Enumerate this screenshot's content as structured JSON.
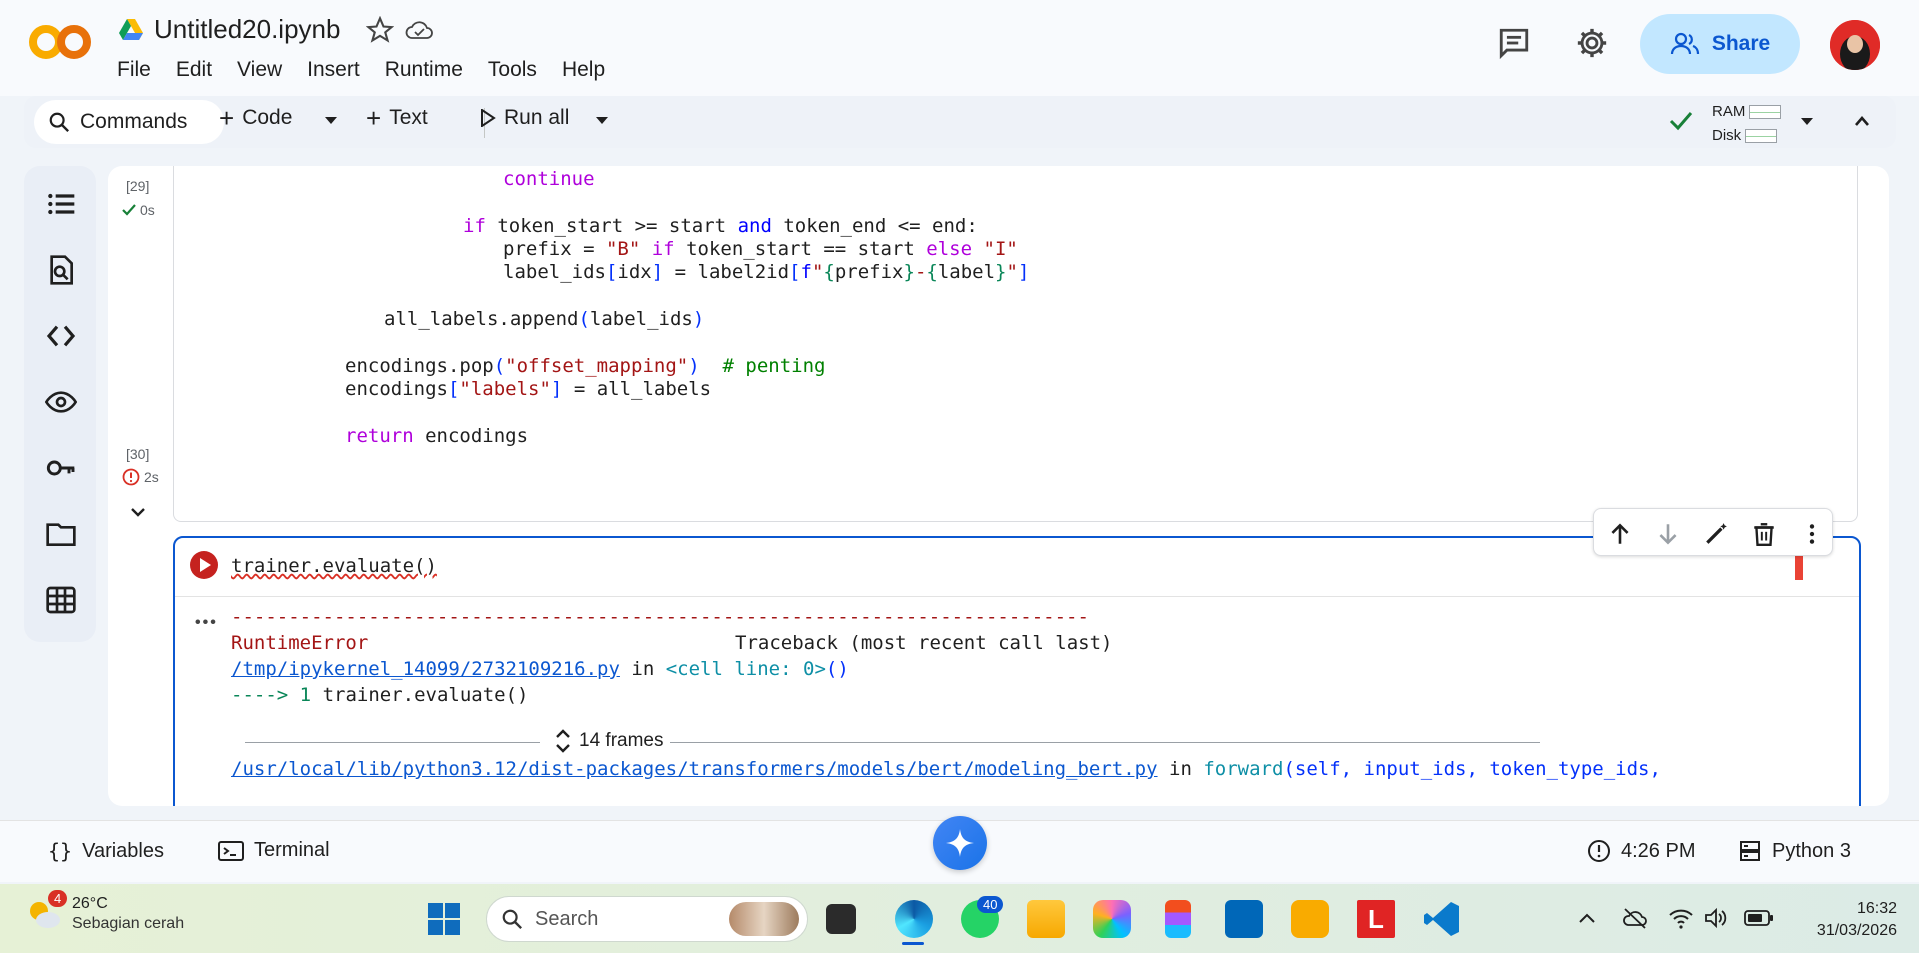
{
  "header": {
    "doc_title": "Untitled20.ipynb",
    "menu": [
      "File",
      "Edit",
      "View",
      "Insert",
      "Runtime",
      "Tools",
      "Help"
    ],
    "share_label": "Share"
  },
  "toolbar": {
    "commands_label": "Commands",
    "code_label": "Code",
    "text_label": "Text",
    "run_all_label": "Run all",
    "ram_label": "RAM",
    "disk_label": "Disk"
  },
  "cells": {
    "cell29": {
      "exec_count": "[29]",
      "exec_time": "0s"
    },
    "cell30": {
      "exec_count": "[30]",
      "exec_time": "2s",
      "code": "trainer.evaluate()",
      "output": {
        "dashes": "---------------------------------------------------------------------------",
        "error_type": "RuntimeError",
        "traceback_label": "Traceback (most recent call last)",
        "file_link": "/tmp/ipykernel_14099/2732109216.py",
        "in_word": "in",
        "cell_ref": "<cell line: 0>",
        "arrow_prefix": "---->",
        "arrow_lineno": "1",
        "arrow_code": "trainer.evaluate()",
        "frames_label": "14 frames",
        "file2_link": "/usr/local/lib/python3.12/dist-packages/transformers/models/bert/modeling_bert.py",
        "forward_name": "forward",
        "forward_args": "(self, input_ids, token_type_ids,"
      }
    }
  },
  "statusbar": {
    "variables_label": "Variables",
    "terminal_label": "Terminal",
    "time": "4:26 PM",
    "runtime": "Python 3"
  },
  "taskbar": {
    "weather_badge": "4",
    "temperature": "26°C",
    "condition": "Sebagian cerah",
    "search_label": "Search",
    "whatsapp_badge": "40",
    "clock_time": "16:32",
    "clock_date": "31/03/2026"
  },
  "colors": {
    "accent": "#0b57d0",
    "share_bg": "#c2e7ff",
    "error_red": "#d93025",
    "keyword_purple": "#af00db",
    "string_red": "#a31515",
    "comment_green": "#008000"
  }
}
